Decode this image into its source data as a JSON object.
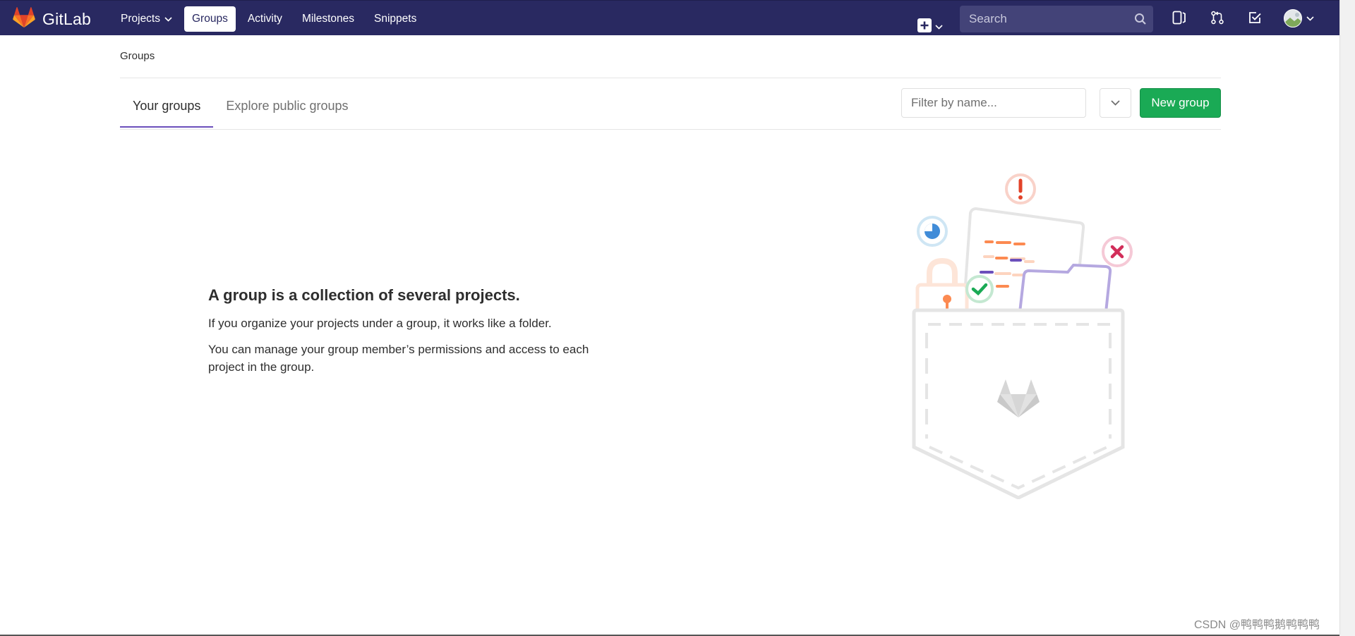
{
  "app": {
    "name": "GitLab",
    "brand_color": "#292961",
    "accent_color": "#1aaa55"
  },
  "navbar": {
    "links": [
      {
        "label": "Projects",
        "has_dropdown": true,
        "active": false
      },
      {
        "label": "Groups",
        "has_dropdown": false,
        "active": true
      },
      {
        "label": "Activity",
        "has_dropdown": false,
        "active": false
      },
      {
        "label": "Milestones",
        "has_dropdown": false,
        "active": false
      },
      {
        "label": "Snippets",
        "has_dropdown": false,
        "active": false
      }
    ],
    "search_placeholder": "Search",
    "icons": [
      "plus-square-icon",
      "sidebar-icon",
      "merge-request-icon",
      "todo-check-icon",
      "user-avatar"
    ]
  },
  "breadcrumb": "Groups",
  "tabs": [
    {
      "label": "Your groups",
      "active": true
    },
    {
      "label": "Explore public groups",
      "active": false
    }
  ],
  "filter": {
    "placeholder": "Filter by name..."
  },
  "new_group_label": "New group",
  "empty_state": {
    "title": "A group is a collection of several projects.",
    "p1": "If you organize your projects under a group, it works like a folder.",
    "p2": "You can manage your group member’s permissions and access to each project in the group."
  },
  "watermark": "CSDN @鸭鸭鸭鹅鸭鸭鸭"
}
